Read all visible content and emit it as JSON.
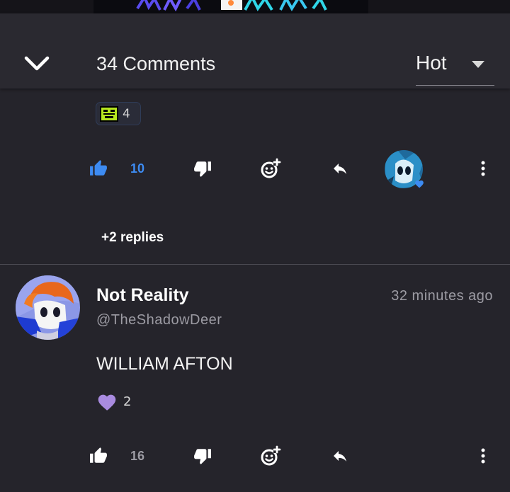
{
  "header": {
    "comment_count_label": "34 Comments",
    "sort": {
      "selected": "Hot"
    }
  },
  "first_comment": {
    "reaction": {
      "icon": "pixel-emoji-icon",
      "count": "4"
    },
    "actions": {
      "like_count": "10"
    },
    "replies_label": "+2 replies"
  },
  "second_comment": {
    "username": "Not Reality",
    "handle": "@TheShadowDeer",
    "timestamp": "32 minutes ago",
    "text": "WILLIAM AFTON",
    "reaction": {
      "icon": "heart-icon",
      "count": "2"
    },
    "actions": {
      "like_count": "16"
    }
  },
  "colors": {
    "background": "#25242b",
    "header": "#2a2930",
    "accent_blue": "#3d8bf2",
    "muted_text": "#9c9ba3",
    "heart_purple": "#a98be0"
  }
}
